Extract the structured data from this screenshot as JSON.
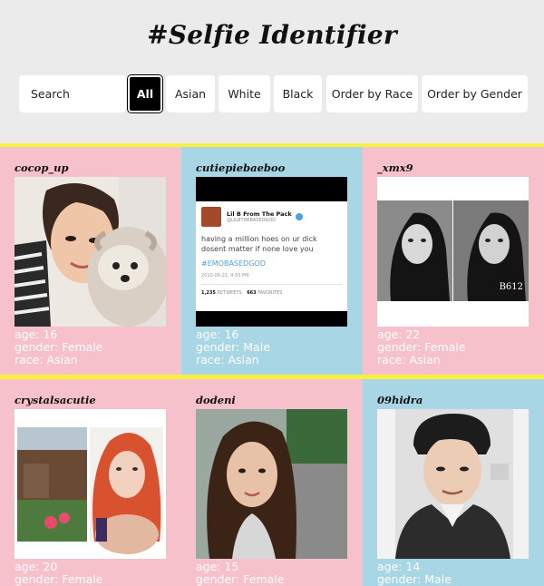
{
  "page": {
    "title": "#Selfie Identifier"
  },
  "filters": {
    "search_placeholder": "Search",
    "buttons": [
      {
        "label": "All",
        "active": true
      },
      {
        "label": "Asian"
      },
      {
        "label": "White"
      },
      {
        "label": "Black"
      },
      {
        "label": "Order by Race"
      },
      {
        "label": "Order by Gender"
      }
    ]
  },
  "cards": [
    {
      "username": "cocop_up",
      "age": "age: 16",
      "gender": "gender: Female",
      "race": "race: Asian",
      "bg": "#f7c1cc"
    },
    {
      "username": "cutiepiebaeboo",
      "age": "age: 16",
      "gender": "gender: Male",
      "race": "race: Asian",
      "bg": "#a9d6e4",
      "tweet": {
        "name": "Lil B From The Pack",
        "handle": "@LILBTHEBASEDGOD",
        "text": "having a million hoes on ur dick dosent matter if none love you",
        "hashtag": "#EMOBASEDGOD",
        "date": "2010-06-21, 9:50 PM",
        "retweets": "1,235",
        "retweets_label": "RETWEETS",
        "favorites": "663",
        "favorites_label": "FAVORITES"
      }
    },
    {
      "username": "_xmx9",
      "age": "age: 22",
      "gender": "gender: Female",
      "race": "race: Asian",
      "bg": "#f7c1cc",
      "watermark": "B612"
    },
    {
      "username": "crystalsacutie",
      "age": "age: 20",
      "gender": "gender: Female",
      "bg": "#f7c1cc"
    },
    {
      "username": "dodeni",
      "age": "age: 15",
      "gender": "gender: Female",
      "bg": "#f7c1cc"
    },
    {
      "username": "09hidra",
      "age": "age: 14",
      "gender": "gender: Male",
      "bg": "#a9d6e4"
    }
  ]
}
